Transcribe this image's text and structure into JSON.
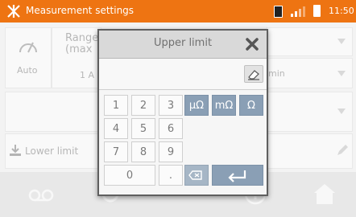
{
  "statusbar": {
    "title": "Measurement settings",
    "clock": "11:50"
  },
  "background": {
    "auto_label": "Auto",
    "range_label": "Range (max",
    "range_value": "1 A",
    "partial_min": "min",
    "lower_limit_label": "Lower limit"
  },
  "dialog": {
    "title": "Upper limit",
    "value": "",
    "keys": {
      "k1": "1",
      "k2": "2",
      "k3": "3",
      "k4": "4",
      "k5": "5",
      "k6": "6",
      "k7": "7",
      "k8": "8",
      "k9": "9",
      "k0": "0",
      "dot": ".",
      "micro_ohm": "µΩ",
      "milli_ohm": "mΩ",
      "ohm": "Ω"
    }
  },
  "colors": {
    "accent": "#ee7412",
    "key_unit": "#8a9fb5"
  }
}
